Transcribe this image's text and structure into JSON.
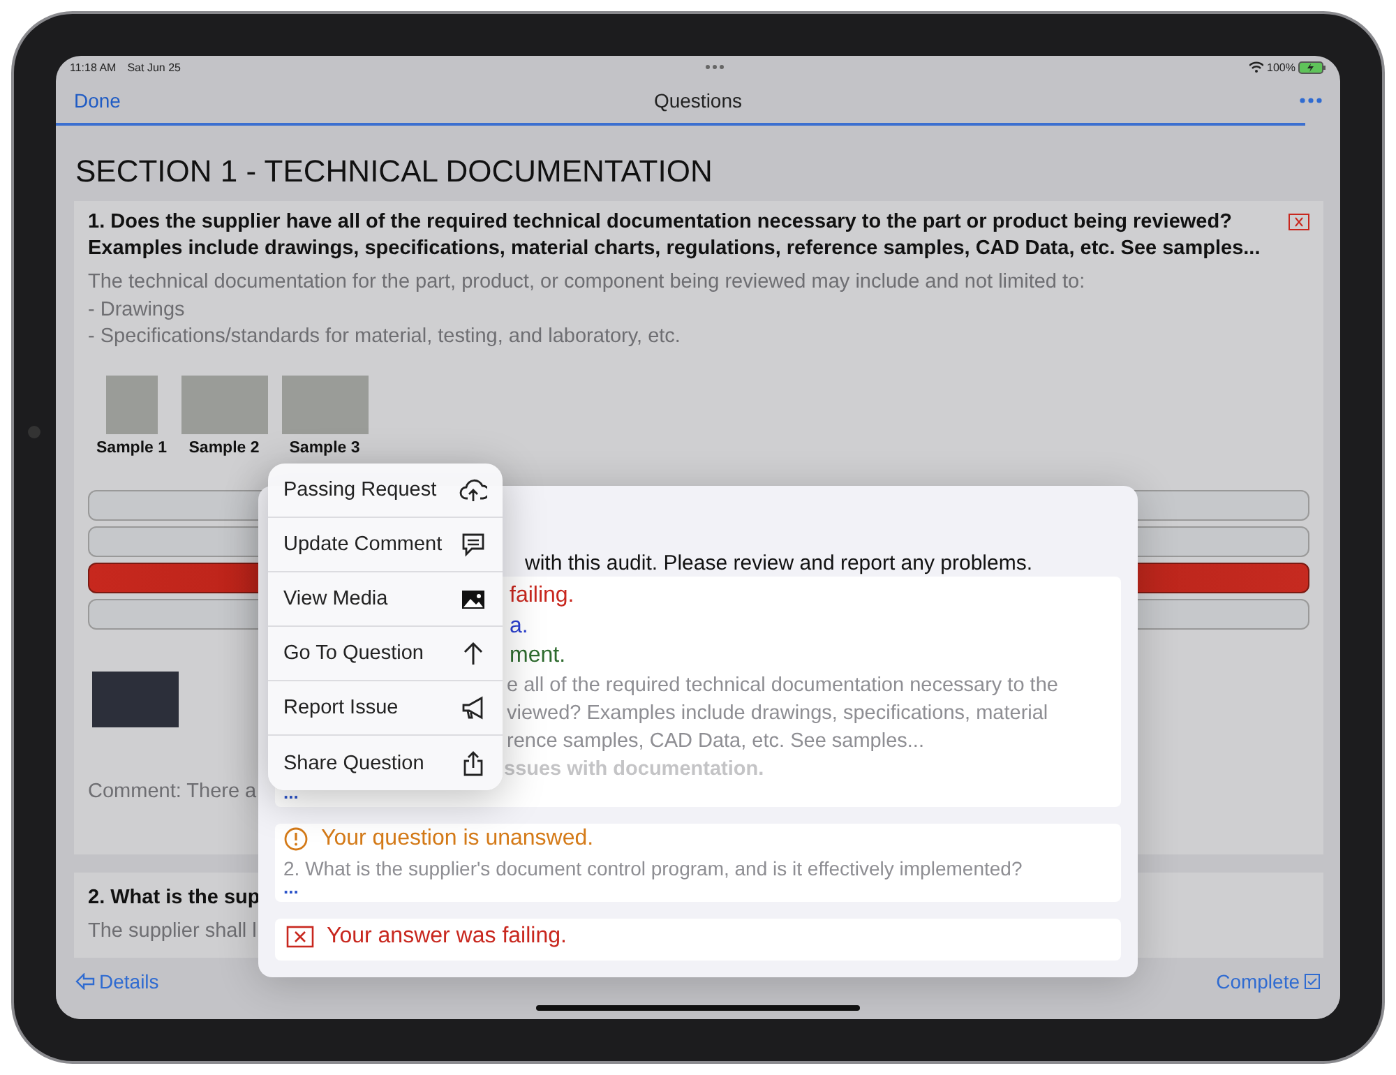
{
  "status_bar": {
    "time": "11:18 AM",
    "date": "Sat Jun 25",
    "battery": "100%"
  },
  "nav": {
    "left": "Done",
    "title": "Questions"
  },
  "section_title": "SECTION 1 - TECHNICAL DOCUMENTATION",
  "question_1": {
    "title": "1. Does the supplier have all of the required technical documentation necessary to the part or product being reviewed? Examples include drawings, specifications, material charts, regulations, reference samples, CAD Data, etc.  See samples...",
    "description": [
      "The technical documentation for the part, product, or component being reviewed may include and not limited to:",
      "- Drawings",
      "- Specifications/standards for material, testing, and laboratory, etc."
    ],
    "samples": [
      "Sample 1",
      "Sample 2",
      "Sample 3"
    ],
    "answers": [
      {
        "selected": false
      },
      {
        "selected": false
      },
      {
        "selected": true
      },
      {
        "selected": false
      }
    ],
    "comment": "Comment: There a"
  },
  "question_2": {
    "title": "2. What is the sup",
    "description": "The supplier shall l"
  },
  "toolbar": {
    "left": "Details",
    "right": "Complete"
  },
  "sheet": {
    "intro": "with this audit. Please review and report any problems.",
    "issues": [
      {
        "kind": "detail",
        "lines": [
          {
            "text": "failing.",
            "color": "#c8271e"
          },
          {
            "text": "a.",
            "color": "#2a3fd0"
          },
          {
            "text": "ment.",
            "color": "#2e6b2e"
          }
        ],
        "question": [
          "e all of the required technical documentation necessary to the",
          "viewed? Examples include drawings, specifications, material",
          "rence samples, CAD Data, etc.  See samples..."
        ],
        "comment": "ssues with documentation.",
        "more": "..."
      },
      {
        "kind": "unanswered",
        "message": "Your question is unanswed.",
        "question": "2. What is the supplier's document control program, and is it effectively implemented?",
        "more": "..."
      },
      {
        "kind": "failing",
        "message": "Your answer was failing."
      }
    ]
  },
  "menu": [
    {
      "label": "Passing Request"
    },
    {
      "label": "Update Comment"
    },
    {
      "label": "View Media"
    },
    {
      "label": "Go To Question"
    },
    {
      "label": "Report Issue"
    },
    {
      "label": "Share Question"
    }
  ]
}
